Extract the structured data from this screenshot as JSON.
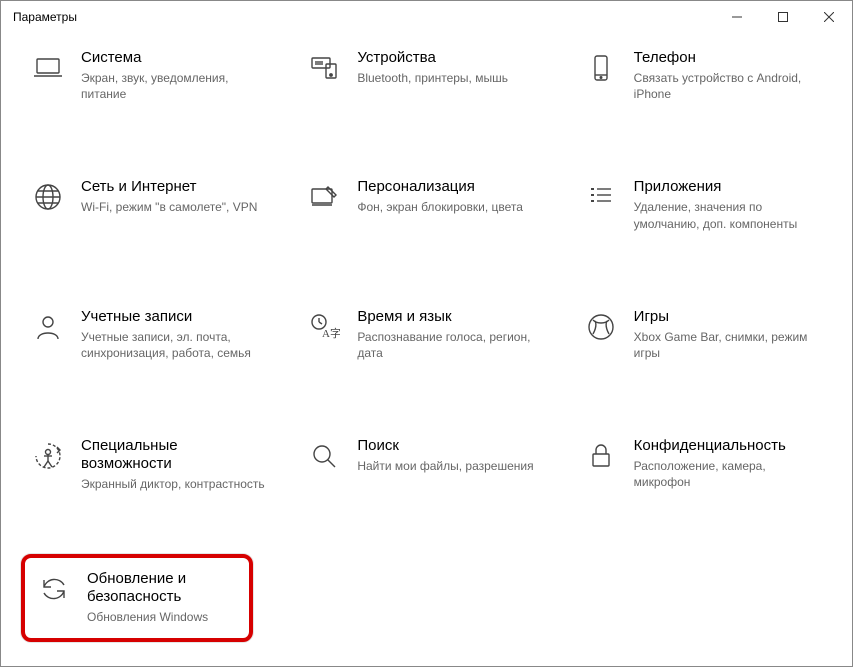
{
  "window": {
    "title": "Параметры"
  },
  "tiles": [
    {
      "title": "Система",
      "desc": "Экран, звук, уведомления, питание"
    },
    {
      "title": "Устройства",
      "desc": "Bluetooth, принтеры, мышь"
    },
    {
      "title": "Телефон",
      "desc": "Связать устройство с Android, iPhone"
    },
    {
      "title": "Сеть и Интернет",
      "desc": "Wi-Fi, режим \"в самолете\", VPN"
    },
    {
      "title": "Персонализация",
      "desc": "Фон, экран блокировки, цвета"
    },
    {
      "title": "Приложения",
      "desc": "Удаление, значения по умолчанию, доп. компоненты"
    },
    {
      "title": "Учетные записи",
      "desc": "Учетные записи, эл. почта, синхронизация, работа, семья"
    },
    {
      "title": "Время и язык",
      "desc": "Распознавание голоса, регион, дата"
    },
    {
      "title": "Игры",
      "desc": "Xbox Game Bar, снимки, режим игры"
    },
    {
      "title": "Специальные возможности",
      "desc": "Экранный диктор, контрастность"
    },
    {
      "title": "Поиск",
      "desc": "Найти мои файлы, разрешения"
    },
    {
      "title": "Конфиденциальность",
      "desc": "Расположение, камера, микрофон"
    },
    {
      "title": "Обновление и безопасность",
      "desc": "Обновления Windows"
    }
  ]
}
